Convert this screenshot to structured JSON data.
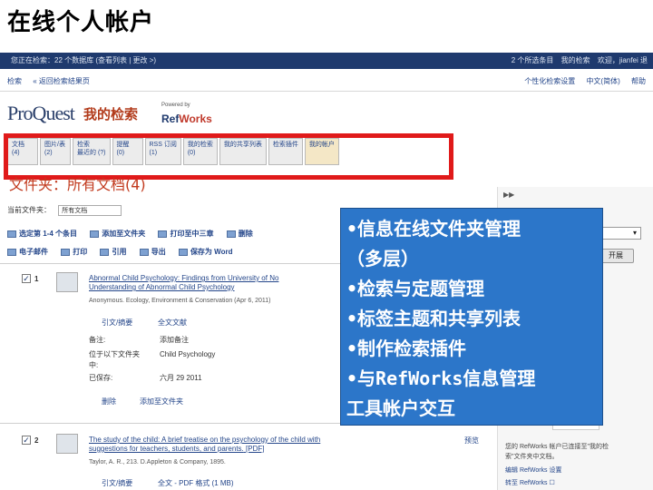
{
  "slide": {
    "title": "在线个人帐户"
  },
  "topbar": {
    "left": "您正在检索：22 个数据库 (查看列表 | 更改 >)",
    "selected": "2 个所选条目",
    "my_search": "我的检索",
    "welcome": "欢迎，jianfei 退"
  },
  "subbar": {
    "search": "检索",
    "back": "« 返回检索结果页",
    "personalize": "个性化检索设置",
    "language": "中文(简体)",
    "help": "帮助"
  },
  "brand": {
    "logo": "ProQuest",
    "section_title": "我的检索",
    "powered_by": "Powered by",
    "refworks_ref": "Ref",
    "refworks_works": "Works"
  },
  "tabs": [
    {
      "line1": "文档",
      "line2": "(4)"
    },
    {
      "line1": "图片/表",
      "line2": "(2)"
    },
    {
      "line1": "检索",
      "line2": "最近的 (?)"
    },
    {
      "line1": "提醒",
      "line2": "(0)"
    },
    {
      "line1": "RSS 订阅",
      "line2": "(1)"
    },
    {
      "line1": "我的检索",
      "line2": "(0)"
    },
    {
      "line1": "我的共享列表",
      "line2": ""
    },
    {
      "line1": "检索插件",
      "line2": ""
    },
    {
      "line1": "我的帐户",
      "line2": ""
    }
  ],
  "folder": {
    "heading": "文件夹：所有文档(4)",
    "current_label": "当前文件夹：",
    "current_value": "所有文档"
  },
  "toolbar1": [
    "选定第 1-4 个条目",
    "添加至文件夹",
    "打印至中三章",
    "删除"
  ],
  "toolbar2": [
    "电子邮件",
    "打印",
    "引用",
    "导出",
    "保存为 Word"
  ],
  "records": [
    {
      "num": "1",
      "title1": "Abnormal Child Psychology: Findings from University of No",
      "title2": "Understanding of Abnormal Child Psychology",
      "meta": "Anonymous. Ecology, Environment & Conservation (Apr 6, 2011)",
      "link_abstract": "引文/摘要",
      "link_fulltext": "全文文献",
      "label_notes": "备注:",
      "label_folder": "位于以下文件夹",
      "label_folder2": "中:",
      "label_saved": "已保存:",
      "value_notes": "添加备注",
      "value_folder": "Child Psychology",
      "value_saved": "六月 29 2011",
      "action_delete": "删除",
      "action_add": "添加至文件夹"
    },
    {
      "num": "2",
      "title1": "The study of the child: A brief treatise on the psychology of the child with",
      "title2": "suggestions for teachers, students, and parents.",
      "title_suffix": "[PDF]",
      "meta": "Taylor, A. R., 213. D.Appleton & Company, 1895.",
      "link_abstract": "引文/摘要",
      "link_fulltext": "全文 - PDF 格式 (1 MB)",
      "preview": "预览"
    }
  ],
  "sidebar": {
    "collapse": "▶▶",
    "go": "开展",
    "note1": "您的 RefWorks 帐户已连接至\"我的检",
    "note2": "索\"文件夹中文档。",
    "note3": "编辑 RefWorks 设置",
    "note4": "转至 RefWorks ☐",
    "rwlogo": "RefWorks"
  },
  "overlay": {
    "lines": [
      "•信息在线文件夹管理",
      "（多层）",
      "•检索与定题管理",
      "•标签主题和共享列表",
      "•制作检索插件",
      "•与RefWorks信息管理",
      "工具帐户交互"
    ]
  },
  "colors": {
    "highlight": "#e01a1a",
    "overlay_bg": "#2c76c9",
    "brand_blue": "#1f3a6e",
    "title_red": "#b23b1b"
  }
}
